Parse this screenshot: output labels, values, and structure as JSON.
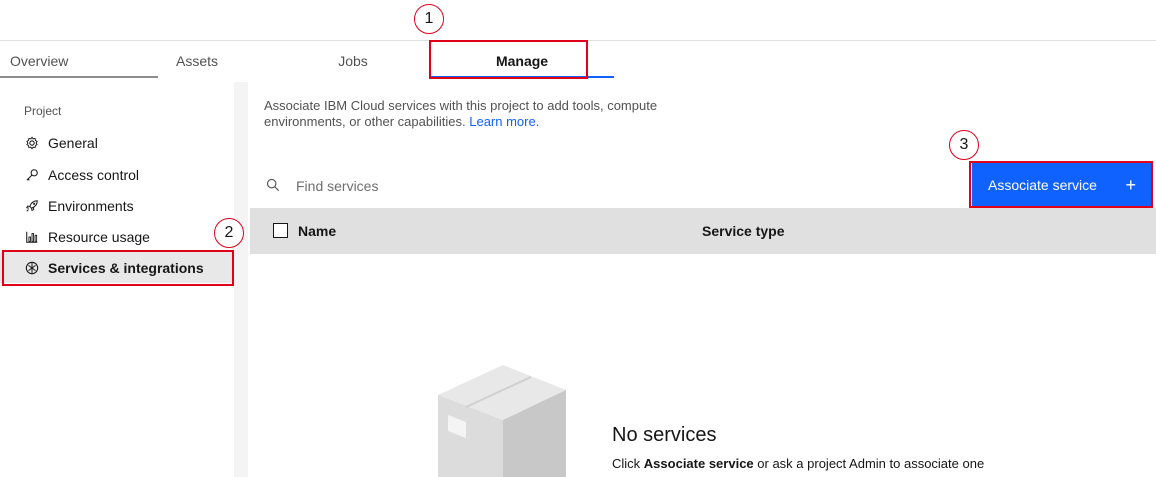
{
  "tabs": [
    {
      "label": "Overview"
    },
    {
      "label": "Assets"
    },
    {
      "label": "Jobs"
    },
    {
      "label": "Manage",
      "active": true
    }
  ],
  "sidebar": {
    "section_label": "Project",
    "items": [
      {
        "label": "General",
        "icon": "gear-icon"
      },
      {
        "label": "Access control",
        "icon": "key-icon"
      },
      {
        "label": "Environments",
        "icon": "rocket-icon"
      },
      {
        "label": "Resource usage",
        "icon": "bar-chart-icon"
      },
      {
        "label": "Services & integrations",
        "icon": "integrations-icon",
        "active": true
      }
    ]
  },
  "main": {
    "intro_text": "Associate IBM Cloud services with this project to add tools, compute environments, or other capabilities.",
    "learn_more": "Learn more.",
    "search_placeholder": "Find services",
    "associate_button": "Associate service",
    "associate_plus": "+",
    "table": {
      "columns": [
        "Name",
        "Service type"
      ]
    },
    "empty_state": {
      "title": "No services",
      "desc_prefix": "Click",
      "desc_bold": "Associate service",
      "desc_suffix": "or ask a project Admin to associate one"
    }
  },
  "annotations": [
    "1",
    "2",
    "3"
  ],
  "colors": {
    "accent": "#0f62fe",
    "annotation": "#e0001a",
    "table_header": "#e0e0e0",
    "active_item": "#e8e8e8"
  }
}
